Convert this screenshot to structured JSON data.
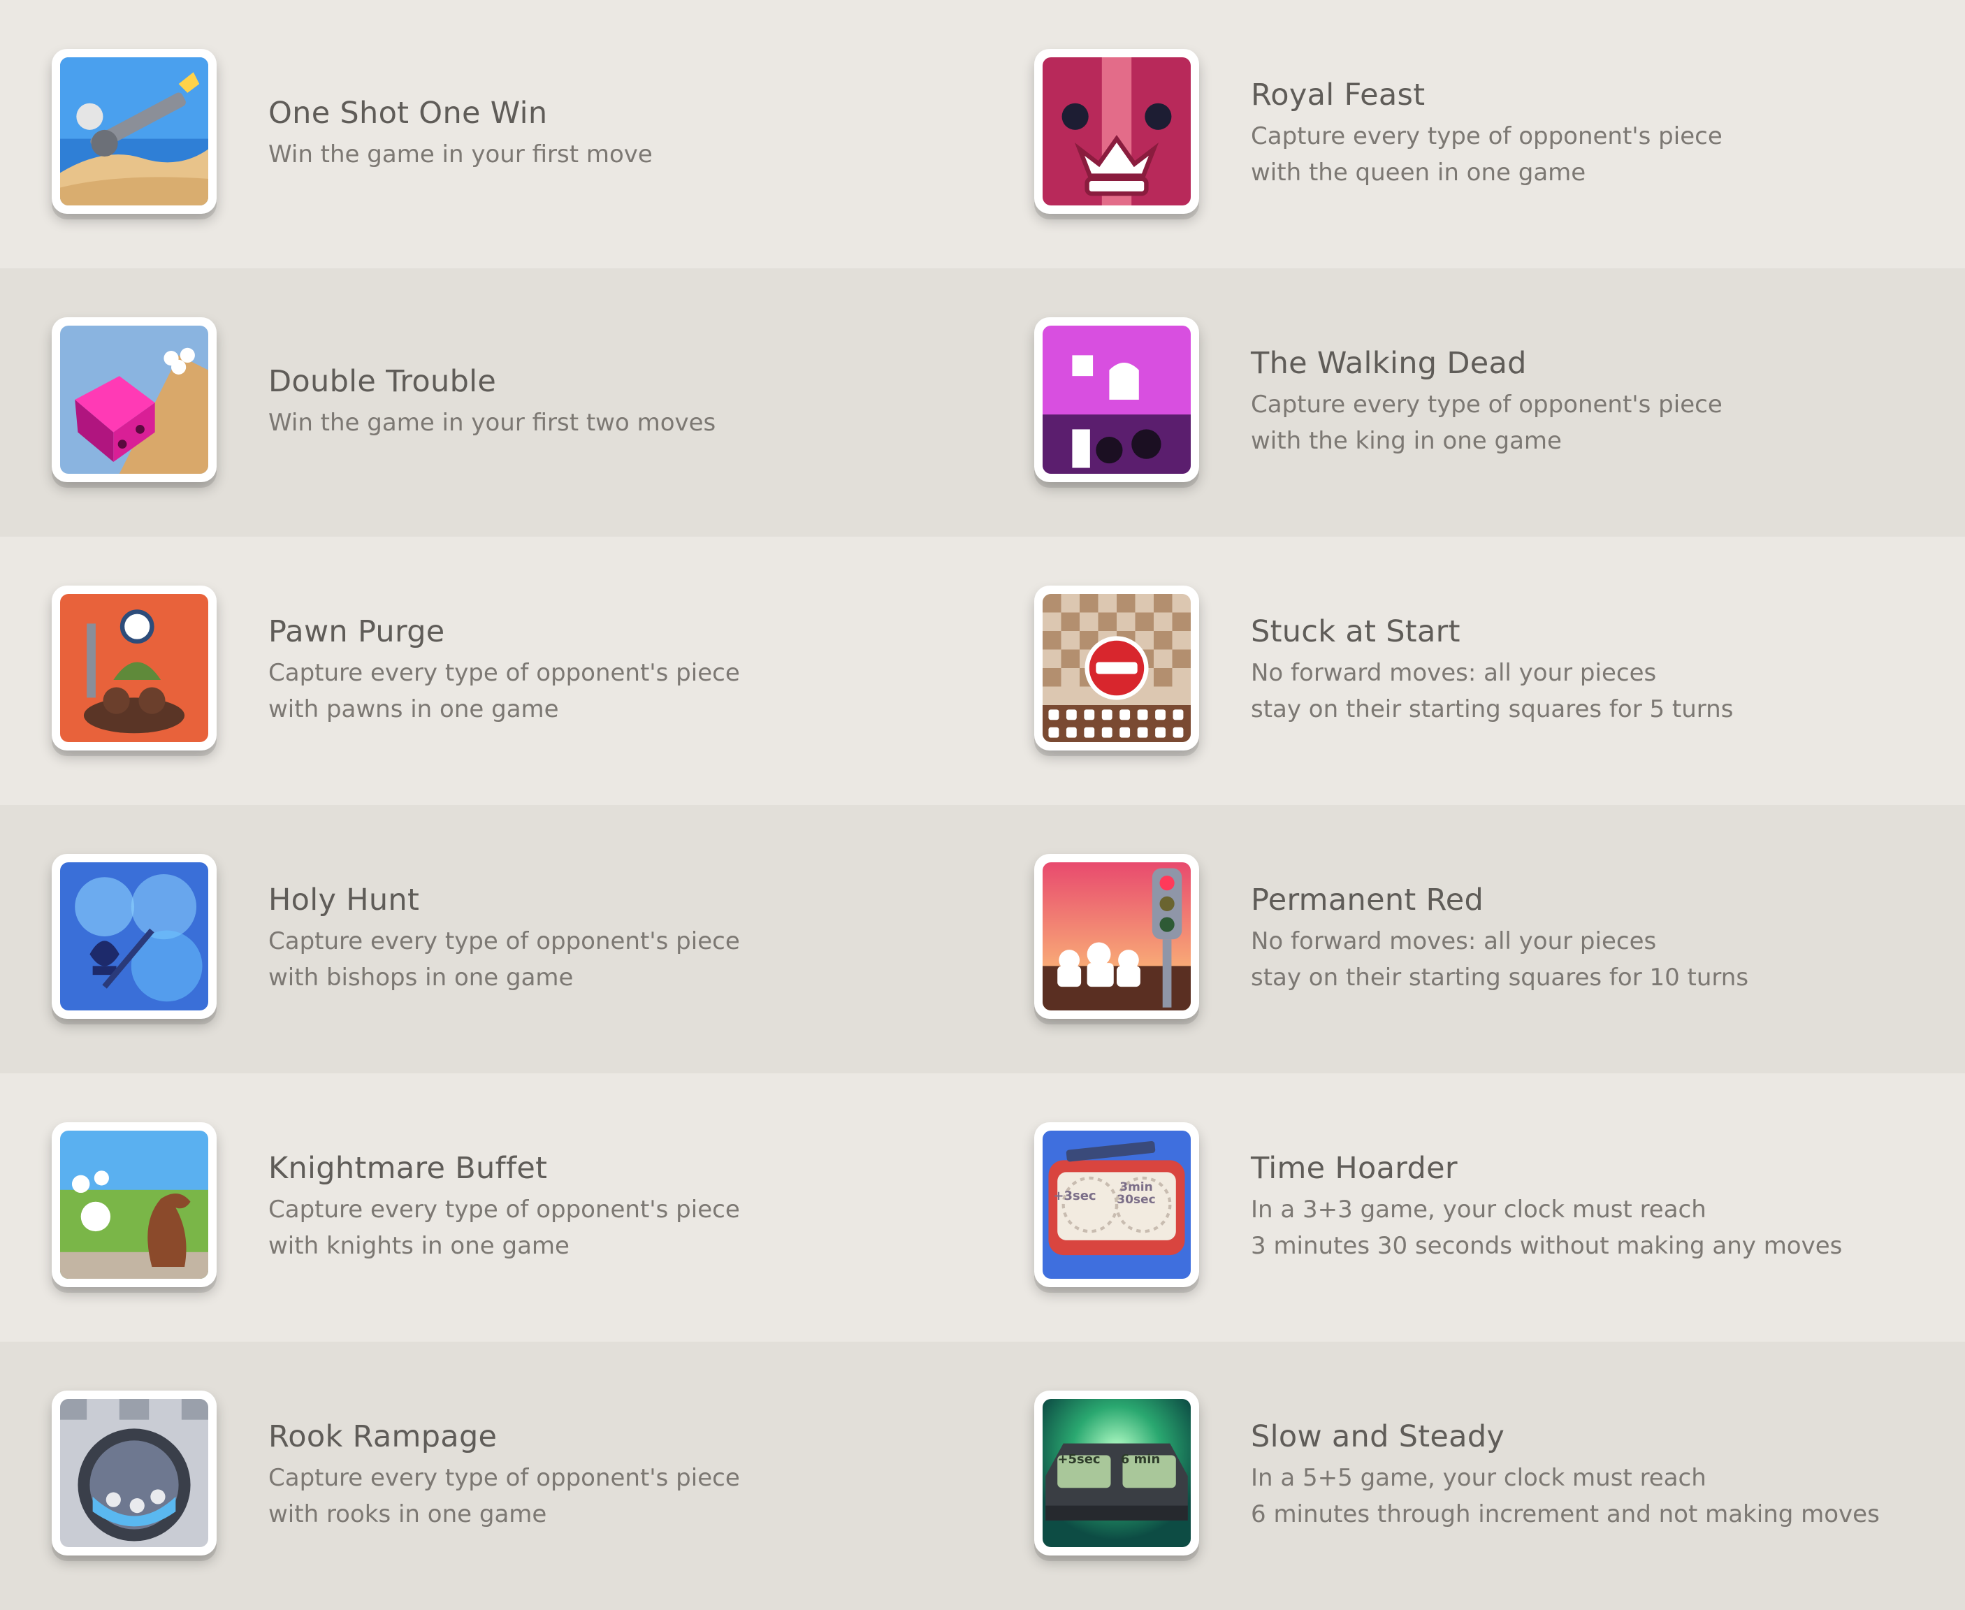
{
  "achievements": [
    {
      "title": "One Shot One Win",
      "lines": [
        "Win the game in your first move",
        ""
      ],
      "icon": "cannon-icon"
    },
    {
      "title": "Royal Feast",
      "lines": [
        "Capture every type of opponent's piece",
        "with the queen in one game"
      ],
      "icon": "queen-crown-icon"
    },
    {
      "title": "Double Trouble",
      "lines": [
        "Win the game in your first two moves",
        ""
      ],
      "icon": "dice-bowling-icon"
    },
    {
      "title": "The Walking Dead",
      "lines": [
        "Capture every type of opponent's piece",
        "with the king in one game"
      ],
      "icon": "zombie-king-icon"
    },
    {
      "title": "Pawn Purge",
      "lines": [
        "Capture every type of opponent's piece",
        "with pawns in one game"
      ],
      "icon": "pawn-warrior-icon"
    },
    {
      "title": "Stuck at Start",
      "lines": [
        "No forward moves: all your pieces",
        "stay on their starting squares for 5 turns"
      ],
      "icon": "no-entry-board-icon"
    },
    {
      "title": "Holy Hunt",
      "lines": [
        "Capture every type of opponent's piece",
        "with bishops in one game"
      ],
      "icon": "bishop-bubbles-icon"
    },
    {
      "title": "Permanent Red",
      "lines": [
        "No forward moves: all your pieces",
        "stay on their starting squares for 10 turns"
      ],
      "icon": "traffic-light-icon"
    },
    {
      "title": "Knightmare Buffet",
      "lines": [
        "Capture every type of opponent's piece",
        "with knights in one game"
      ],
      "icon": "knight-field-icon"
    },
    {
      "title": "Time Hoarder",
      "lines": [
        "In a 3+3 game, your clock must reach",
        "3 minutes 30 seconds without making any moves"
      ],
      "icon": "chess-clock-red-icon",
      "clock": [
        "+3sec",
        "3min 30sec"
      ]
    },
    {
      "title": "Rook Rampage",
      "lines": [
        "Capture every type of opponent's piece",
        "with rooks in one game"
      ],
      "icon": "rook-tower-icon"
    },
    {
      "title": "Slow and Steady",
      "lines": [
        "In a 5+5 game, your clock must reach",
        "6 minutes through increment and not making moves"
      ],
      "icon": "chess-clock-dark-icon",
      "clock": [
        "+5sec",
        "6 min"
      ]
    }
  ]
}
